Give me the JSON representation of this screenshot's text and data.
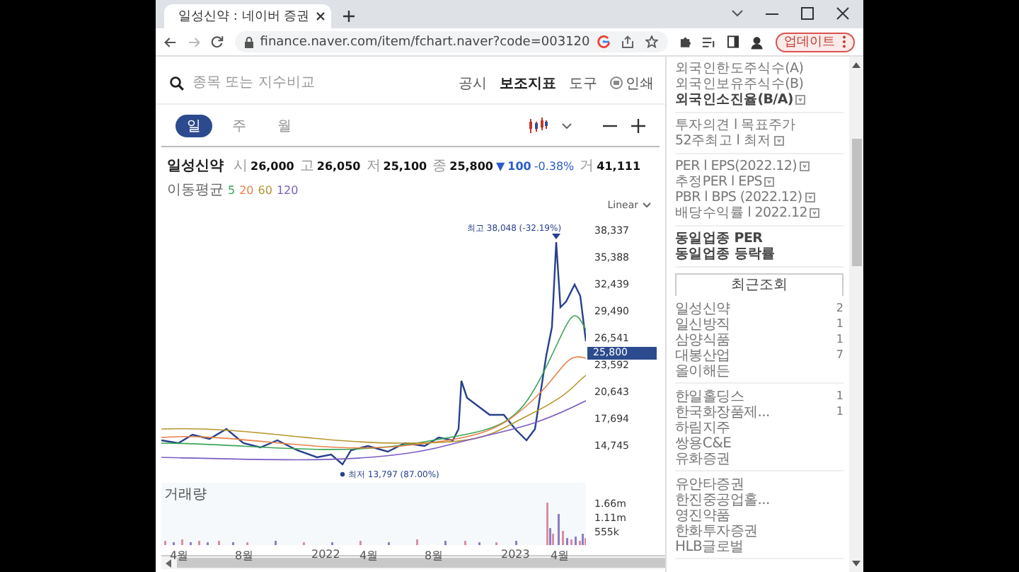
{
  "browser": {
    "tab": {
      "title": "일성신약 : 네이버 증권"
    },
    "url": "finance.naver.com/item/fchart.naver?code=003120",
    "update_button": "업데이트"
  },
  "toolbar": {
    "search": {
      "placeholder": "종목 또는 지수비교"
    },
    "links": [
      {
        "label": "공시",
        "bold": false
      },
      {
        "label": "보조지표",
        "bold": true
      },
      {
        "label": "도구",
        "bold": false
      },
      {
        "label": "인쇄",
        "bold": false,
        "kind": "print"
      }
    ]
  },
  "periods": [
    {
      "label": "일",
      "selected": true
    },
    {
      "label": "주",
      "selected": false
    },
    {
      "label": "월",
      "selected": false
    }
  ],
  "quote": {
    "name": "일성신약",
    "fields": [
      {
        "label": "시",
        "value": "26,000"
      },
      {
        "label": "고",
        "value": "26,050"
      },
      {
        "label": "저",
        "value": "25,100"
      },
      {
        "label": "종",
        "value": "25,800"
      }
    ],
    "change_arrow": "▼",
    "change": "100",
    "change_pct": "-0.38%",
    "volume_label": "거",
    "volume": "41,111"
  },
  "moving_average": {
    "label": "이동평균",
    "periods": [
      {
        "label": "5",
        "color": "#3aa655"
      },
      {
        "label": "20",
        "color": "#e8814a"
      },
      {
        "label": "60",
        "color": "#b8962e"
      },
      {
        "label": "120",
        "color": "#7b5cc4"
      }
    ]
  },
  "chart": {
    "scale": "Linear",
    "price_ticks": [
      "38,337",
      "35,388",
      "32,439",
      "29,490",
      "26,541",
      "23,592",
      "20,643",
      "17,694",
      "14,745"
    ],
    "current_price": "25,800",
    "high_note": "최고 38,048 (-32.19%)",
    "low_note": "최저 13,797 (87.00%)",
    "volume_title": "거래량",
    "volume_ticks": [
      "1.66m",
      "1.11m",
      "555k"
    ],
    "x_labels": [
      "4월",
      "8월",
      "2022",
      "4월",
      "8월",
      "2023",
      "4월"
    ]
  },
  "sidebar": {
    "info_groups": [
      [
        {
          "label": "외국인한도주식수(A)",
          "bold": false,
          "help": false
        },
        {
          "label": "외국인보유주식수(B)",
          "bold": false,
          "help": false
        },
        {
          "label": "외국인소진율(B/A)",
          "bold": true,
          "help": true
        }
      ],
      [
        {
          "label": "투자의견 l 목표주가",
          "bold": false,
          "help": false
        },
        {
          "label": "52주최고 l 최저",
          "bold": false,
          "help": true
        }
      ],
      [
        {
          "label": "PER l EPS(2022.12)",
          "bold": false,
          "help": true
        },
        {
          "label": "추정PER l EPS",
          "bold": false,
          "help": true
        },
        {
          "label": "PBR l BPS (2022.12)",
          "bold": false,
          "help": true
        },
        {
          "label": "배당수익률 l 2022.12",
          "bold": false,
          "help": true
        }
      ],
      [
        {
          "label": "동일업종 PER",
          "bold": true,
          "help": false
        },
        {
          "label": "동일업종 등락률",
          "bold": true,
          "help": false
        }
      ]
    ],
    "recent_tab": "최근조회",
    "recent_groups": [
      [
        {
          "name": "일성신약",
          "value": "2"
        },
        {
          "name": "일신방직",
          "value": "1"
        },
        {
          "name": "삼양식품",
          "value": "1"
        },
        {
          "name": "대봉산업",
          "value": "7"
        },
        {
          "name": "올이해든"
        }
      ],
      [
        {
          "name": "한일홀딩스",
          "value": "1"
        },
        {
          "name": "한국화장품제...",
          "value": "1"
        },
        {
          "name": "하림지주"
        },
        {
          "name": "쌍용C&E"
        },
        {
          "name": "유화증권"
        }
      ],
      [
        {
          "name": "유안타증권"
        },
        {
          "name": "한진중공업홀..."
        },
        {
          "name": "영진약품"
        },
        {
          "name": "한화투자증권"
        },
        {
          "name": "HLB글로벌"
        }
      ]
    ]
  }
}
